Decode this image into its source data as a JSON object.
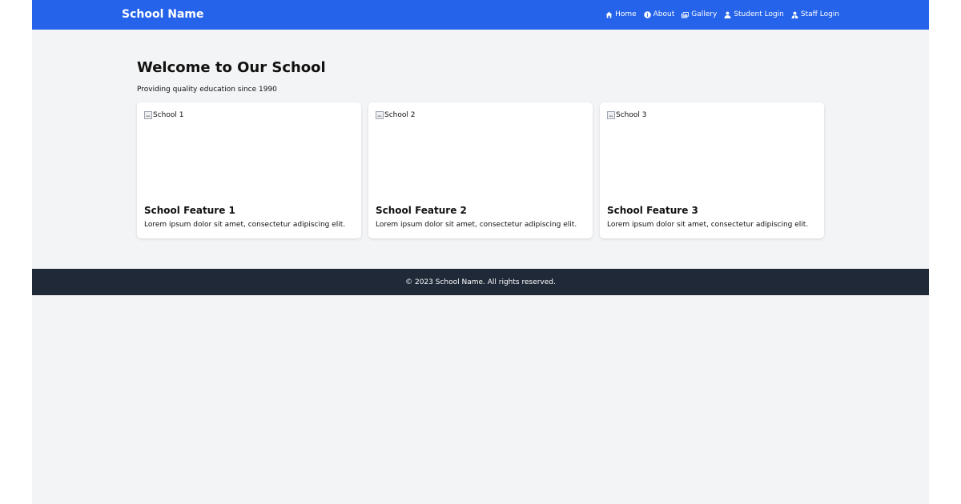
{
  "header": {
    "brand": "School Name",
    "nav": [
      {
        "label": "Home",
        "icon": "home-icon"
      },
      {
        "label": "About",
        "icon": "info-icon"
      },
      {
        "label": "Gallery",
        "icon": "images-icon"
      },
      {
        "label": "Student Login",
        "icon": "user-icon"
      },
      {
        "label": "Staff Login",
        "icon": "user-tie-icon"
      }
    ]
  },
  "hero": {
    "title": "Welcome to Our School",
    "subtitle": "Providing quality education since 1990"
  },
  "cards": [
    {
      "image_alt": "School 1",
      "title": "School Feature 1",
      "text": "Lorem ipsum dolor sit amet, consectetur adipiscing elit."
    },
    {
      "image_alt": "School 2",
      "title": "School Feature 2",
      "text": "Lorem ipsum dolor sit amet, consectetur adipiscing elit."
    },
    {
      "image_alt": "School 3",
      "title": "School Feature 3",
      "text": "Lorem ipsum dolor sit amet, consectetur adipiscing elit."
    }
  ],
  "footer": {
    "text": "© 2023 School Name. All rights reserved."
  },
  "colors": {
    "navbar": "#2563eb",
    "footer": "#1f2937",
    "background": "#f3f4f6",
    "card": "#ffffff"
  }
}
